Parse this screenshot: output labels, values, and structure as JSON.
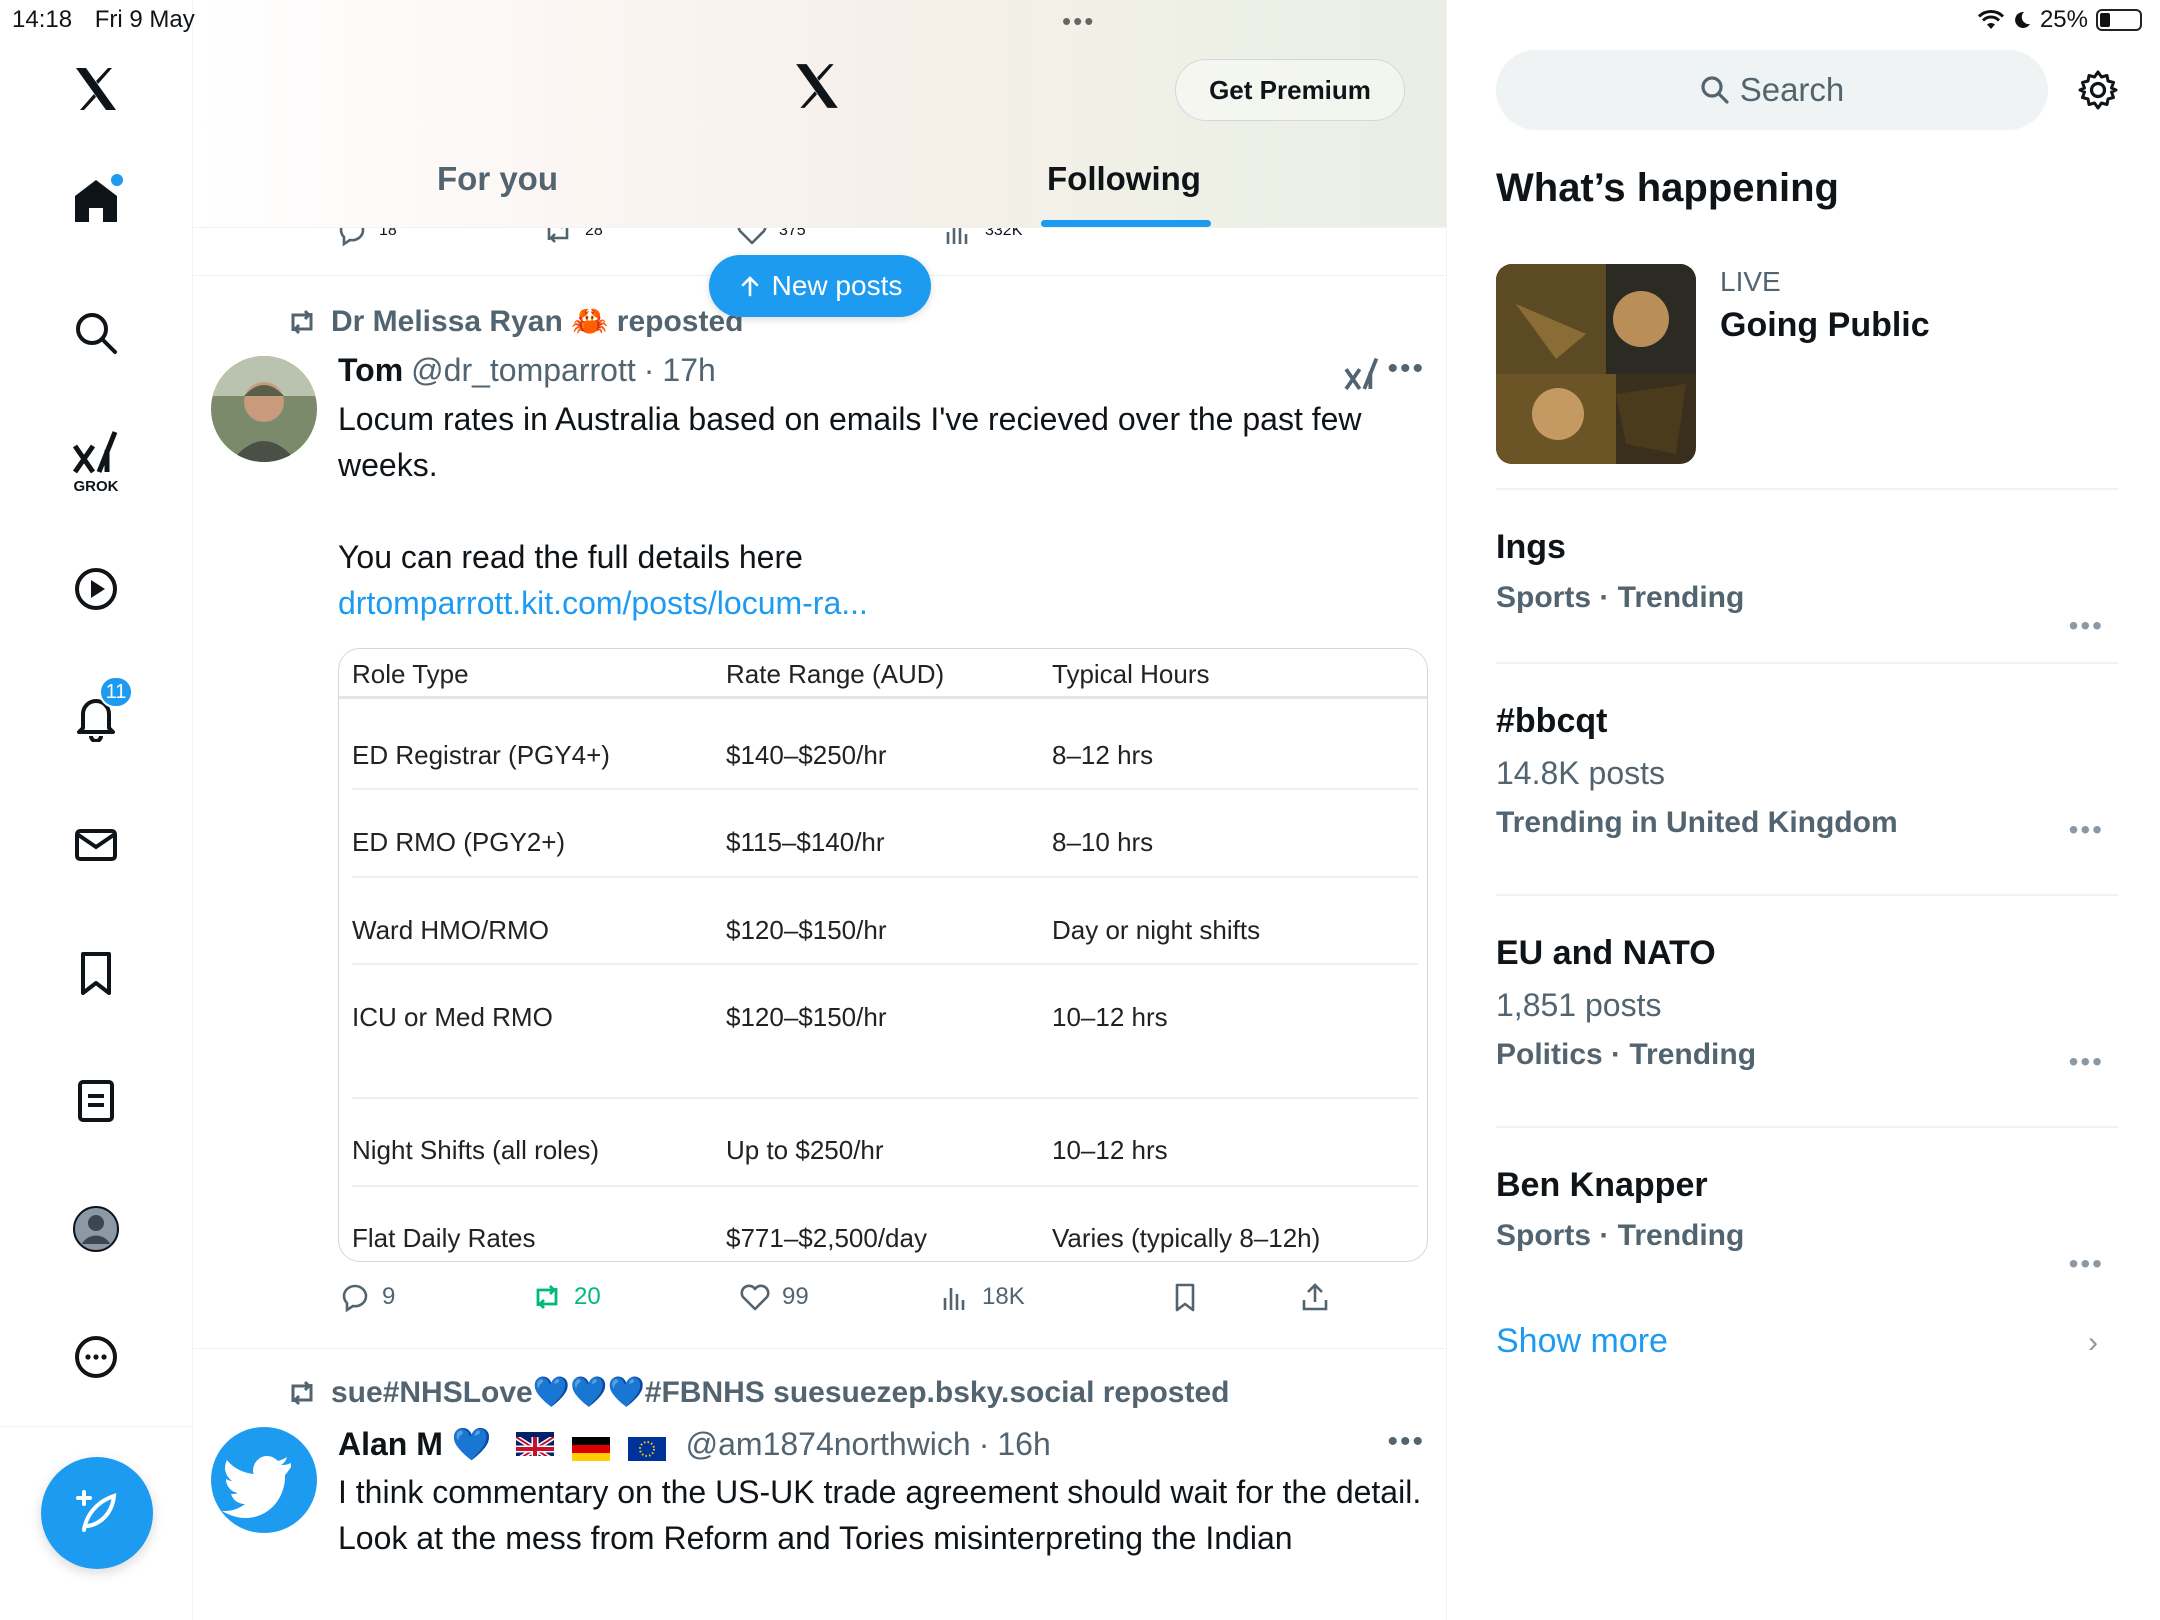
{
  "status_bar": {
    "time": "14:18",
    "date": "Fri 9 May",
    "battery": "25%"
  },
  "nav": {
    "notifications_badge": "11",
    "grok_label": "GROK"
  },
  "header": {
    "premium_label": "Get Premium",
    "tabs": [
      {
        "label": "For you"
      },
      {
        "label": "Following"
      }
    ],
    "new_posts_label": "New posts"
  },
  "prev_post_actions": {
    "replies": "18",
    "reposts": "28",
    "likes": "375",
    "views": "332K"
  },
  "post1": {
    "reposted_by": "Dr Melissa Ryan 🦀 reposted",
    "author_name": "Tom",
    "author_handle": "@dr_tomparrott",
    "time": "17h",
    "text_line1": "Locum rates in Australia based on emails I've recieved over the past few weeks.",
    "text_line2": "You can read the full details here",
    "link": "drtomparrott.kit.com/posts/locum-ra...",
    "table": {
      "headers": [
        "Role Type",
        "Rate Range (AUD)",
        "Typical Hours"
      ],
      "rows": [
        [
          "ED Registrar (PGY4+)",
          "$140–$250/hr",
          "8–12 hrs"
        ],
        [
          "ED RMO (PGY2+)",
          "$115–$140/hr",
          "8–10 hrs"
        ],
        [
          "Ward HMO/RMO",
          "$120–$150/hr",
          "Day or night shifts"
        ],
        [
          "ICU or Med RMO",
          "$120–$150/hr",
          "10–12 hrs"
        ],
        [
          "Night Shifts (all roles)",
          "Up to $250/hr",
          "10–12 hrs"
        ],
        [
          "Flat Daily Rates",
          "$771–$2,500/day",
          "Varies (typically 8–12h)"
        ]
      ]
    },
    "actions": {
      "replies": "9",
      "reposts": "20",
      "likes": "99",
      "views": "18K"
    }
  },
  "post2": {
    "reposted_by": "sue#NHSLove💙💙💙#FBNHS suesuezep.bsky.social reposted",
    "author_name": "Alan M 💙",
    "author_handle": "@am1874northwich",
    "time": "16h",
    "text": "I think commentary on the US-UK trade agreement should wait for the detail.",
    "text_2": "Look at the mess from Reform and Tories misinterpreting the Indian"
  },
  "sidebar": {
    "search_placeholder": "Search",
    "whats_happening": "What’s happening",
    "live": {
      "label": "LIVE",
      "title": "Going Public"
    },
    "trends": [
      {
        "name": "Ings",
        "count": "",
        "meta": "Sports · Trending"
      },
      {
        "name": "#bbcqt",
        "count": "14.8K posts",
        "meta": "Trending in United Kingdom"
      },
      {
        "name": "EU and NATO",
        "count": "1,851 posts",
        "meta": "Politics · Trending"
      },
      {
        "name": "Ben Knapper",
        "count": "",
        "meta": "Sports · Trending"
      }
    ],
    "show_more": "Show more"
  },
  "colors": {
    "accent": "#1d9bf0",
    "repost_green": "#00ba7c",
    "secondary_text": "#536471"
  }
}
